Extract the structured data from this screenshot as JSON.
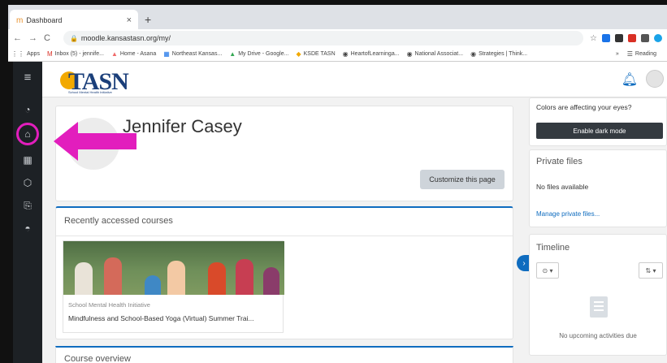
{
  "browser": {
    "tab_title": "Dashboard",
    "tab_close": "×",
    "new_tab": "+",
    "url": "moodle.kansastasn.org/my/",
    "nav": {
      "back": "←",
      "forward": "→",
      "reload": "C"
    },
    "bookmarks": [
      {
        "icon": "⋮⋮",
        "label": "Apps"
      },
      {
        "icon": "M",
        "label": "Inbox (5) - jennife..."
      },
      {
        "icon": "▲",
        "label": "Home - Asana"
      },
      {
        "icon": "▦",
        "label": "Northeast Kansas..."
      },
      {
        "icon": "▲",
        "label": "My Drive - Google..."
      },
      {
        "icon": "◆",
        "label": "KSDE TASN"
      },
      {
        "icon": "◉",
        "label": "HeartofLearninga..."
      },
      {
        "icon": "◉",
        "label": "National Associat..."
      },
      {
        "icon": "◉",
        "label": "Strategies | Think..."
      }
    ],
    "bookmarks_more": "»",
    "reading_list": "Reading"
  },
  "drawer": {
    "menu_icon": "≡",
    "icons": [
      "dashboard-icon",
      "home-icon",
      "calendar-icon",
      "files-icon",
      "clipboard-icon",
      "graduation-cap-icon"
    ]
  },
  "logo": {
    "word": "TASN",
    "tagline": "School Mental Health Initiative"
  },
  "header": {
    "title": "Jennifer Casey",
    "customize_label": "Customize this page"
  },
  "recent": {
    "title": "Recently accessed courses",
    "course_category": "School Mental Health Initiative",
    "course_name": "Mindfulness and School-Based Yoga (Virtual) Summer Trai..."
  },
  "overview": {
    "title": "Course overview"
  },
  "blocks": {
    "dark_question": "Colors are affecting your eyes?",
    "dark_button": "Enable dark mode",
    "files_title": "Private files",
    "files_empty": "No files available",
    "files_manage": "Manage private files...",
    "timeline_title": "Timeline",
    "timeline_filter": "⊙ ▾",
    "timeline_sort": "⇅ ▾",
    "timeline_empty": "No upcoming activities due"
  },
  "colors": {
    "highlight": "#e21ebd",
    "brand_blue": "#0f6cbf",
    "drawer": "#1d2125"
  }
}
